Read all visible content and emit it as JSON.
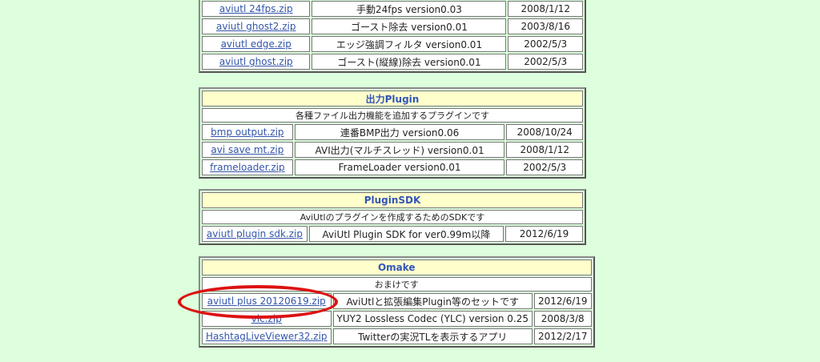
{
  "filter_table": {
    "rows": [
      {
        "file": "aviutl 24fps.zip",
        "desc": "手動24fps version0.03",
        "date": "2008/1/12"
      },
      {
        "file": "aviutl ghost2.zip",
        "desc": "ゴースト除去 version0.01",
        "date": "2003/8/16"
      },
      {
        "file": "aviutl edge.zip",
        "desc": "エッジ強調フィルタ version0.01",
        "date": "2002/5/3"
      },
      {
        "file": "aviutl ghost.zip",
        "desc": "ゴースト(縦線)除去 version0.01",
        "date": "2002/5/3"
      }
    ]
  },
  "output_table": {
    "title": "出力Plugin",
    "subtitle": "各種ファイル出力機能を追加するプラグインです",
    "rows": [
      {
        "file": "bmp output.zip",
        "desc": "連番BMP出力 version0.06",
        "date": "2008/10/24"
      },
      {
        "file": "avi save mt.zip",
        "desc": "AVI出力(マルチスレッド) version0.01",
        "date": "2008/1/12"
      },
      {
        "file": "frameloader.zip",
        "desc": "FrameLoader version0.01",
        "date": "2002/5/3"
      }
    ]
  },
  "sdk_table": {
    "title": "PluginSDK",
    "subtitle": "AviUtlのプラグインを作成するためのSDKです",
    "rows": [
      {
        "file": "aviutl plugin sdk.zip",
        "desc": "AviUtl Plugin SDK for ver0.99m以降",
        "date": "2012/6/19"
      }
    ]
  },
  "omake_table": {
    "title": "Omake",
    "subtitle": "おまけです",
    "rows": [
      {
        "file": "aviutl plus 20120619.zip",
        "desc": "AviUtlと拡張編集Plugin等のセットです",
        "date": "2012/6/19"
      },
      {
        "file": "vlc.zip",
        "desc": "YUY2 Lossless Codec (YLC) version 0.25",
        "date": "2008/3/8"
      },
      {
        "file": "HashtagLiveViewer32.zip",
        "desc": "Twitterの実況TLを表示するアプリ",
        "date": "2012/2/17"
      }
    ]
  },
  "colors": {
    "page_bg": "#ddffdd",
    "header_bg": "#ffffcc",
    "link": "#3355aa",
    "highlight_ellipse": "#dd1111"
  }
}
